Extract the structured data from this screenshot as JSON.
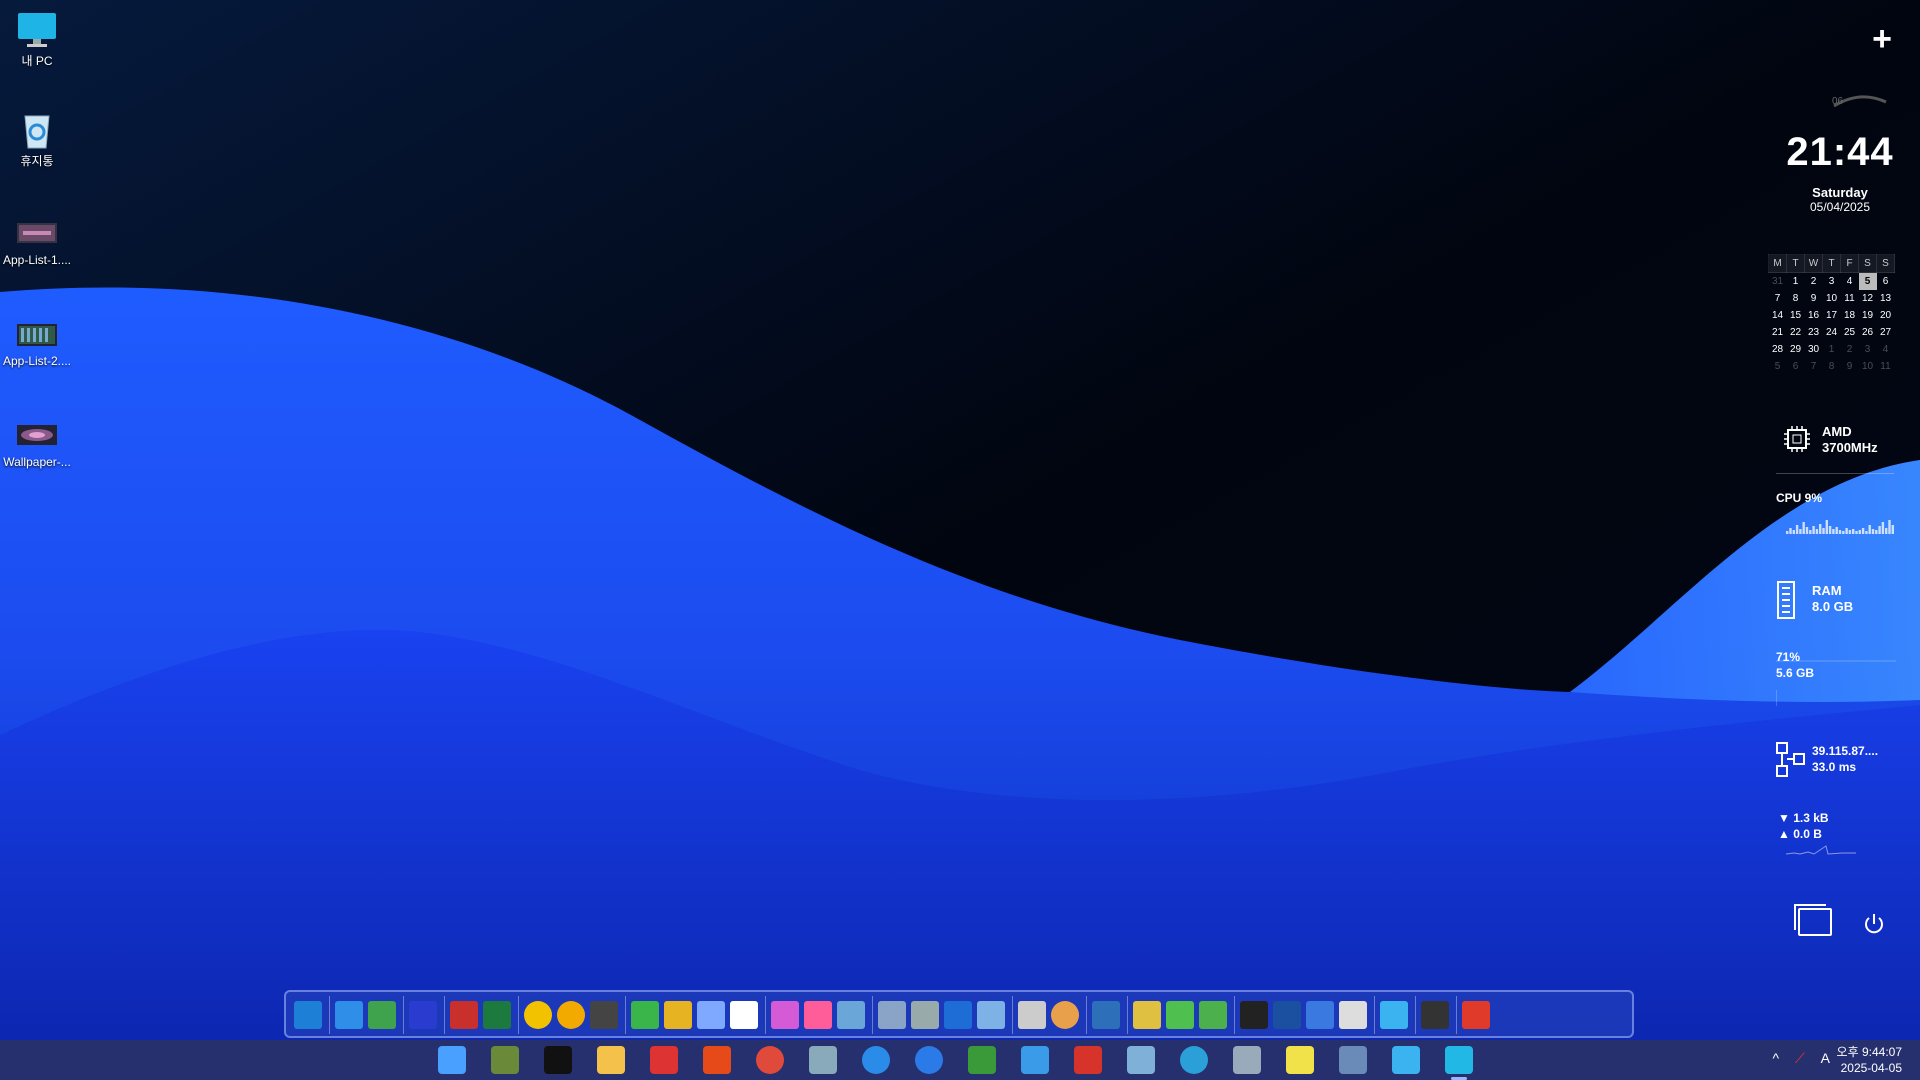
{
  "desktop": {
    "icons": [
      {
        "label": "내 PC",
        "icon": "monitor-icon"
      },
      {
        "label": "휴지통",
        "icon": "recycle-bin-icon"
      },
      {
        "label": "App-List-1....",
        "icon": "image-file-icon"
      },
      {
        "label": "App-List-2....",
        "icon": "image-file-icon"
      },
      {
        "label": "Wallpaper-...",
        "icon": "image-file-icon"
      }
    ]
  },
  "widgets": {
    "add_label": "+",
    "clock": {
      "arc_number": "06",
      "time": "21:44",
      "day": "Saturday",
      "date": "05/04/2025"
    },
    "calendar": {
      "headers": [
        "M",
        "T",
        "W",
        "T",
        "F",
        "S",
        "S"
      ],
      "weeks": [
        [
          "31",
          "1",
          "2",
          "3",
          "4",
          "5",
          "6"
        ],
        [
          "7",
          "8",
          "9",
          "10",
          "11",
          "12",
          "13"
        ],
        [
          "14",
          "15",
          "16",
          "17",
          "18",
          "19",
          "20"
        ],
        [
          "21",
          "22",
          "23",
          "24",
          "25",
          "26",
          "27"
        ],
        [
          "28",
          "29",
          "30",
          "1",
          "2",
          "3",
          "4"
        ],
        [
          "5",
          "6",
          "7",
          "8",
          "9",
          "10",
          "11"
        ]
      ],
      "today": "5"
    },
    "cpu_model": {
      "vendor": "AMD",
      "speed": "3700MHz"
    },
    "cpu_usage": {
      "label": "CPU 9%",
      "value_percent": 9
    },
    "ram": {
      "label": "RAM",
      "size": "8.0 GB"
    },
    "ram_usage": {
      "percent": "71%",
      "used": "5.6 GB",
      "value_percent": 71
    },
    "network": {
      "ip": "39.115.87....",
      "ping": "33.0 ms"
    },
    "traffic": {
      "down": "1.3 kB",
      "up": "0.0 B"
    }
  },
  "dock": {
    "icons": [
      "show-desktop-icon",
      "remote-icon",
      "app-installer-icon",
      "grid-app-icon",
      "document-list-icon",
      "excel-icon",
      "media-player-icon",
      "triangle-app-icon",
      "photo-app-icon",
      "puzzle-icon",
      "tools-icon",
      "search-tool-icon",
      "panel-app-icon",
      "info-icon",
      "windows-store-icon",
      "book-icon",
      "network-disk-icon",
      "drives-icon",
      "settings-gears-icon",
      "plugin-icon",
      "eraser-icon",
      "disc-icon",
      "user-icon",
      "lock-icon",
      "sync-icon",
      "torrent-icon",
      "chip-icon",
      "remote-desktop-icon",
      "wrench-icon",
      "toolkit-icon",
      "magnifier-icon",
      "gamepad-icon",
      "power-icon"
    ]
  },
  "taskbar": {
    "apps": [
      "start-icon",
      "gpu-icon",
      "terminal-icon",
      "file-explorer-icon",
      "notepad-icon",
      "search-app-icon",
      "chrome-icon",
      "disk-tool-icon",
      "refresh-app-icon",
      "updater-icon",
      "network-tool-icon",
      "briefcase-icon",
      "photo-editor-icon",
      "notebook-icon",
      "edge-icon",
      "calculator-icon",
      "sticky-icon",
      "pc-tool-icon",
      "photos-icon",
      "monitor-app-icon"
    ],
    "tray": {
      "chevron": "^",
      "ime": "A"
    },
    "clock": {
      "time": "오후 9:44:07",
      "date": "2025-04-05"
    }
  }
}
